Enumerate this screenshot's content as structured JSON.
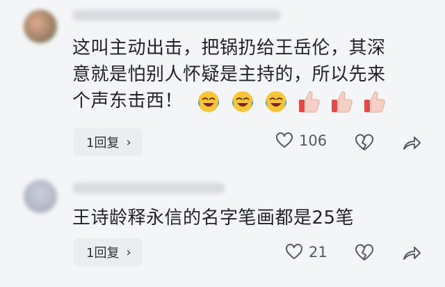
{
  "comments": [
    {
      "text_lines": [
        "这叫主动出击，把锅扔给王岳伦，其深",
        "意就是怕别人怀疑是主持的，所以先来",
        "个声东击西！"
      ],
      "reactions": [
        "crying-laughing",
        "crying-laughing",
        "crying-laughing",
        "thumbs-up",
        "thumbs-up",
        "thumbs-up"
      ],
      "reply_label": "1回复",
      "like_count": "106"
    },
    {
      "text_lines": [
        "王诗龄释永信的名字笔画都是25笔"
      ],
      "reply_label": "1回复",
      "like_count": "21"
    }
  ],
  "icons": {
    "like": "heart-outline-icon",
    "dislike": "broken-heart-icon",
    "share": "share-arrow-icon",
    "reply_chevron": "chevron-right-icon"
  },
  "colors": {
    "background": "#f4f5f7",
    "text": "#1f2329",
    "muted": "#555a61",
    "reply_bg": "#ebedf0"
  }
}
